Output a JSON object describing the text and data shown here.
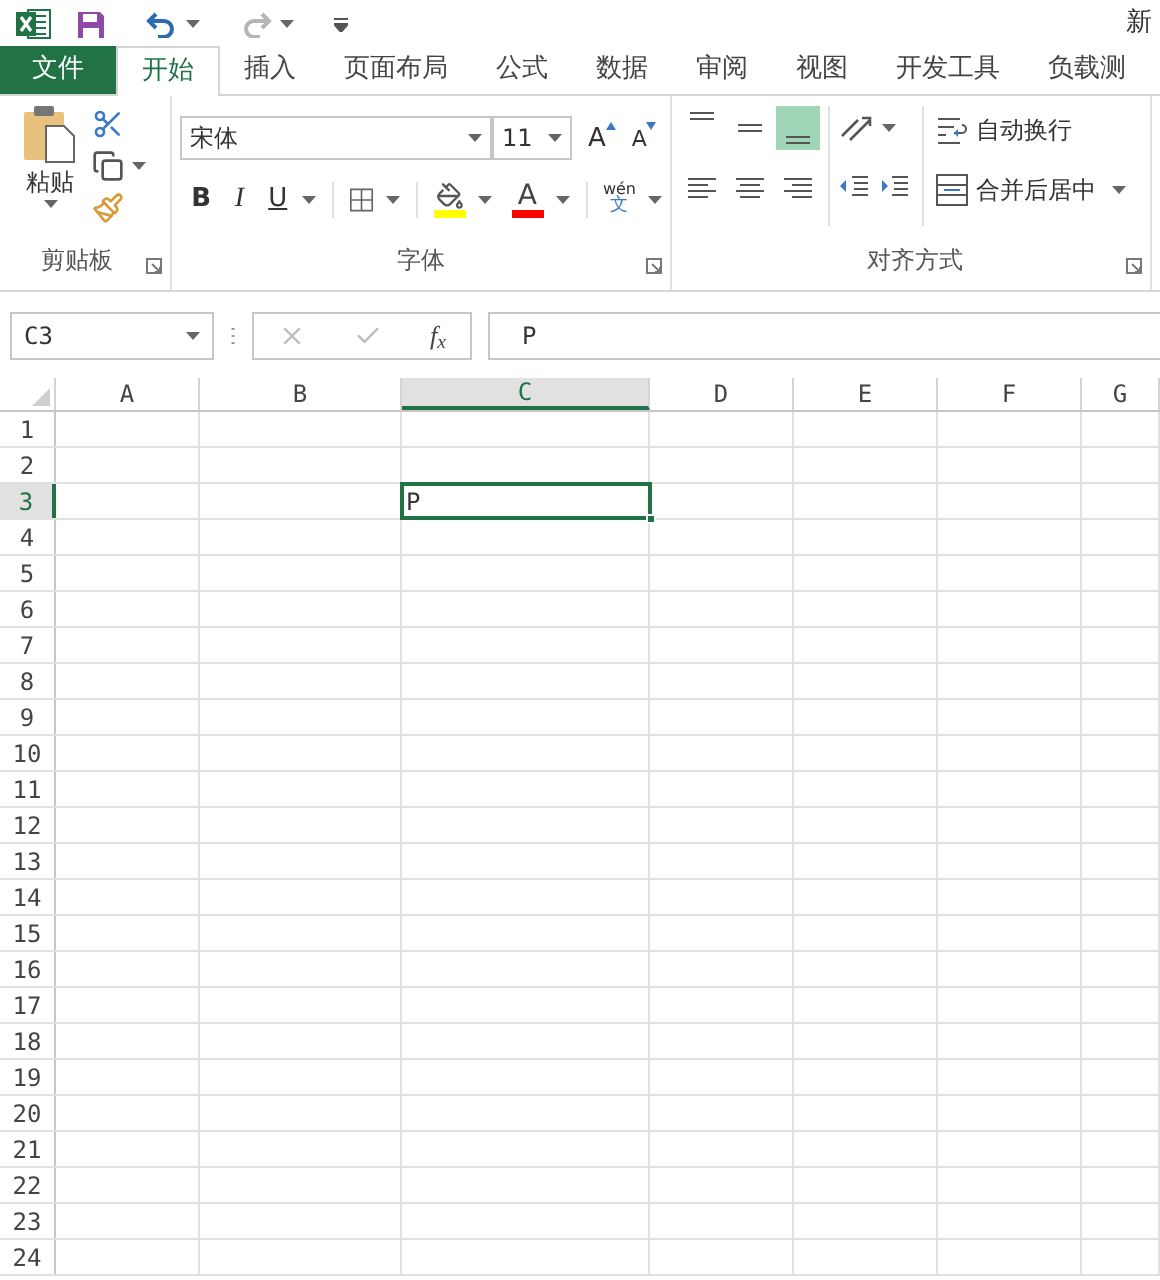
{
  "title_bar": {
    "title": "新"
  },
  "tabs": [
    {
      "label": "文件",
      "kind": "file",
      "selected": false
    },
    {
      "label": "开始",
      "kind": "tab",
      "selected": true
    },
    {
      "label": "插入",
      "kind": "tab",
      "selected": false
    },
    {
      "label": "页面布局",
      "kind": "tab",
      "selected": false
    },
    {
      "label": "公式",
      "kind": "tab",
      "selected": false
    },
    {
      "label": "数据",
      "kind": "tab",
      "selected": false
    },
    {
      "label": "审阅",
      "kind": "tab",
      "selected": false
    },
    {
      "label": "视图",
      "kind": "tab",
      "selected": false
    },
    {
      "label": "开发工具",
      "kind": "tab",
      "selected": false
    },
    {
      "label": "负载测",
      "kind": "tab",
      "selected": false
    }
  ],
  "ribbon": {
    "clipboard": {
      "paste_label": "粘贴",
      "group_label": "剪贴板"
    },
    "font": {
      "font_name": "宋体",
      "font_size": "11",
      "grow_glyph": "A",
      "shrink_glyph": "A",
      "bold_glyph": "B",
      "italic_glyph": "I",
      "underline_glyph": "U",
      "font_color_glyph": "A",
      "phonetic_top": "wén",
      "phonetic_bottom": "文",
      "group_label": "字体"
    },
    "alignment": {
      "vertical": [
        {
          "kind": "top",
          "selected": false
        },
        {
          "kind": "middle",
          "selected": false
        },
        {
          "kind": "bottom",
          "selected": true
        }
      ],
      "horizontal": [
        {
          "kind": "left",
          "selected": false
        },
        {
          "kind": "center",
          "selected": false
        },
        {
          "kind": "right",
          "selected": false
        }
      ],
      "wrap_text": "自动换行",
      "merge_center": "合并后居中",
      "group_label": "对齐方式"
    }
  },
  "formula_bar": {
    "name_box": "C3",
    "fx_label": "f$_{x}$",
    "value": "P"
  },
  "sheet": {
    "columns": [
      {
        "label": "A",
        "selected": false
      },
      {
        "label": "B",
        "selected": false
      },
      {
        "label": "C",
        "selected": true
      },
      {
        "label": "D",
        "selected": false
      },
      {
        "label": "E",
        "selected": false
      },
      {
        "label": "F",
        "selected": false
      },
      {
        "label": "G",
        "selected": false
      }
    ],
    "rows": [
      {
        "label": "1",
        "selected": false
      },
      {
        "label": "2",
        "selected": false
      },
      {
        "label": "3",
        "selected": true
      },
      {
        "label": "4",
        "selected": false
      },
      {
        "label": "5",
        "selected": false
      },
      {
        "label": "6",
        "selected": false
      },
      {
        "label": "7",
        "selected": false
      },
      {
        "label": "8",
        "selected": false
      },
      {
        "label": "9",
        "selected": false
      },
      {
        "label": "10",
        "selected": false
      },
      {
        "label": "11",
        "selected": false
      },
      {
        "label": "12",
        "selected": false
      },
      {
        "label": "13",
        "selected": false
      },
      {
        "label": "14",
        "selected": false
      },
      {
        "label": "15",
        "selected": false
      },
      {
        "label": "16",
        "selected": false
      },
      {
        "label": "17",
        "selected": false
      },
      {
        "label": "18",
        "selected": false
      },
      {
        "label": "19",
        "selected": false
      },
      {
        "label": "20",
        "selected": false
      },
      {
        "label": "21",
        "selected": false
      },
      {
        "label": "22",
        "selected": false
      },
      {
        "label": "23",
        "selected": false
      },
      {
        "label": "24",
        "selected": false
      }
    ],
    "cells": [
      {
        "value": "P",
        "selected": true
      }
    ]
  }
}
